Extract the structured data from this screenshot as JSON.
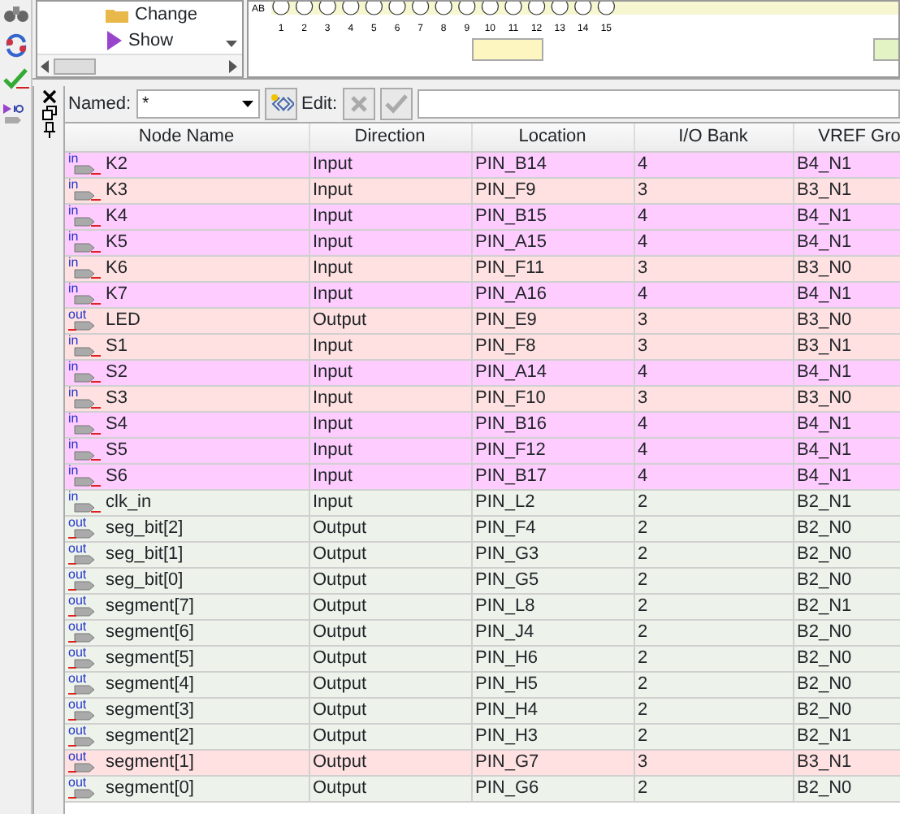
{
  "tree": {
    "items": [
      {
        "label": "Change"
      },
      {
        "label": "Show"
      }
    ]
  },
  "pin_planner": {
    "row_label": "AB",
    "pin_numbers": [
      "1",
      "2",
      "3",
      "4",
      "5",
      "6",
      "7",
      "8",
      "9",
      "10",
      "11",
      "12",
      "13",
      "14",
      "15"
    ]
  },
  "filter": {
    "named_label": "Named:",
    "named_value": "*",
    "edit_label": "Edit:"
  },
  "table": {
    "columns": [
      "Node Name",
      "Direction",
      "Location",
      "I/O Bank",
      "VREF Gro"
    ],
    "rows": [
      {
        "kind": "input",
        "port_label": "in",
        "name": "K2",
        "direction": "Input",
        "location": "PIN_B14",
        "bank": "4",
        "vref": "B4_N1",
        "color": "#ffccff"
      },
      {
        "kind": "input",
        "port_label": "in",
        "name": "K3",
        "direction": "Input",
        "location": "PIN_F9",
        "bank": "3",
        "vref": "B3_N1",
        "color": "#ffe1e1"
      },
      {
        "kind": "input",
        "port_label": "in",
        "name": "K4",
        "direction": "Input",
        "location": "PIN_B15",
        "bank": "4",
        "vref": "B4_N1",
        "color": "#ffccff"
      },
      {
        "kind": "input",
        "port_label": "in",
        "name": "K5",
        "direction": "Input",
        "location": "PIN_A15",
        "bank": "4",
        "vref": "B4_N1",
        "color": "#ffccff"
      },
      {
        "kind": "input",
        "port_label": "in",
        "name": "K6",
        "direction": "Input",
        "location": "PIN_F11",
        "bank": "3",
        "vref": "B3_N0",
        "color": "#ffe1e1"
      },
      {
        "kind": "input",
        "port_label": "in",
        "name": "K7",
        "direction": "Input",
        "location": "PIN_A16",
        "bank": "4",
        "vref": "B4_N1",
        "color": "#ffccff"
      },
      {
        "kind": "output",
        "port_label": "out",
        "name": "LED",
        "direction": "Output",
        "location": "PIN_E9",
        "bank": "3",
        "vref": "B3_N0",
        "color": "#ffe1e1"
      },
      {
        "kind": "input",
        "port_label": "in",
        "name": "S1",
        "direction": "Input",
        "location": "PIN_F8",
        "bank": "3",
        "vref": "B3_N1",
        "color": "#ffe1e1"
      },
      {
        "kind": "input",
        "port_label": "in",
        "name": "S2",
        "direction": "Input",
        "location": "PIN_A14",
        "bank": "4",
        "vref": "B4_N1",
        "color": "#ffccff"
      },
      {
        "kind": "input",
        "port_label": "in",
        "name": "S3",
        "direction": "Input",
        "location": "PIN_F10",
        "bank": "3",
        "vref": "B3_N0",
        "color": "#ffe1e1"
      },
      {
        "kind": "input",
        "port_label": "in",
        "name": "S4",
        "direction": "Input",
        "location": "PIN_B16",
        "bank": "4",
        "vref": "B4_N1",
        "color": "#ffccff"
      },
      {
        "kind": "input",
        "port_label": "in",
        "name": "S5",
        "direction": "Input",
        "location": "PIN_F12",
        "bank": "4",
        "vref": "B4_N1",
        "color": "#ffccff"
      },
      {
        "kind": "input",
        "port_label": "in",
        "name": "S6",
        "direction": "Input",
        "location": "PIN_B17",
        "bank": "4",
        "vref": "B4_N1",
        "color": "#ffccff"
      },
      {
        "kind": "input",
        "port_label": "in",
        "name": "clk_in",
        "direction": "Input",
        "location": "PIN_L2",
        "bank": "2",
        "vref": "B2_N1",
        "color": "#edf3eb"
      },
      {
        "kind": "output",
        "port_label": "out",
        "name": "seg_bit[2]",
        "direction": "Output",
        "location": "PIN_F4",
        "bank": "2",
        "vref": "B2_N0",
        "color": "#edf3eb"
      },
      {
        "kind": "output",
        "port_label": "out",
        "name": "seg_bit[1]",
        "direction": "Output",
        "location": "PIN_G3",
        "bank": "2",
        "vref": "B2_N0",
        "color": "#edf3eb"
      },
      {
        "kind": "output",
        "port_label": "out",
        "name": "seg_bit[0]",
        "direction": "Output",
        "location": "PIN_G5",
        "bank": "2",
        "vref": "B2_N0",
        "color": "#edf3eb"
      },
      {
        "kind": "output",
        "port_label": "out",
        "name": "segment[7]",
        "direction": "Output",
        "location": "PIN_L8",
        "bank": "2",
        "vref": "B2_N1",
        "color": "#edf3eb"
      },
      {
        "kind": "output",
        "port_label": "out",
        "name": "segment[6]",
        "direction": "Output",
        "location": "PIN_J4",
        "bank": "2",
        "vref": "B2_N0",
        "color": "#edf3eb"
      },
      {
        "kind": "output",
        "port_label": "out",
        "name": "segment[5]",
        "direction": "Output",
        "location": "PIN_H6",
        "bank": "2",
        "vref": "B2_N0",
        "color": "#edf3eb"
      },
      {
        "kind": "output",
        "port_label": "out",
        "name": "segment[4]",
        "direction": "Output",
        "location": "PIN_H5",
        "bank": "2",
        "vref": "B2_N0",
        "color": "#edf3eb"
      },
      {
        "kind": "output",
        "port_label": "out",
        "name": "segment[3]",
        "direction": "Output",
        "location": "PIN_H4",
        "bank": "2",
        "vref": "B2_N0",
        "color": "#edf3eb"
      },
      {
        "kind": "output",
        "port_label": "out",
        "name": "segment[2]",
        "direction": "Output",
        "location": "PIN_H3",
        "bank": "2",
        "vref": "B2_N1",
        "color": "#edf3eb"
      },
      {
        "kind": "output",
        "port_label": "out",
        "name": "segment[1]",
        "direction": "Output",
        "location": "PIN_G7",
        "bank": "3",
        "vref": "B3_N1",
        "color": "#ffe1e1"
      },
      {
        "kind": "output",
        "port_label": "out",
        "name": "segment[0]",
        "direction": "Output",
        "location": "PIN_G6",
        "bank": "2",
        "vref": "B2_N0",
        "color": "#edf3eb"
      }
    ]
  }
}
